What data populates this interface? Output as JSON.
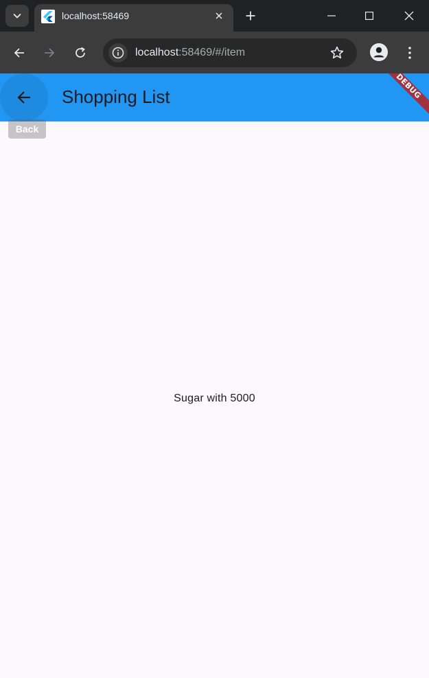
{
  "browser": {
    "tab": {
      "title": "localhost:58469"
    },
    "toolbar": {
      "url_host": "localhost",
      "url_rest": ":58469/#/item"
    }
  },
  "app": {
    "appbar": {
      "title": "Shopping List",
      "background_color": "#2196f3"
    },
    "debug_banner": {
      "label": "DEBUG"
    },
    "back_tooltip": {
      "label": "Back"
    },
    "body": {
      "text": "Sugar with 5000",
      "background_color": "#fdf7fe"
    }
  },
  "icons": {
    "tab_search": "chevron-down-icon",
    "favicon": "flutter-icon",
    "tab_close": "close-icon",
    "new_tab": "plus-icon",
    "minimize": "minimize-icon",
    "maximize": "maximize-icon",
    "close_window": "close-icon",
    "back": "arrow-left-icon",
    "forward": "arrow-right-icon",
    "reload": "reload-icon",
    "site_info": "info-icon",
    "bookmark": "star-icon",
    "profile": "account-icon",
    "menu": "more-vert-icon",
    "app_back": "arrow-left-icon"
  }
}
